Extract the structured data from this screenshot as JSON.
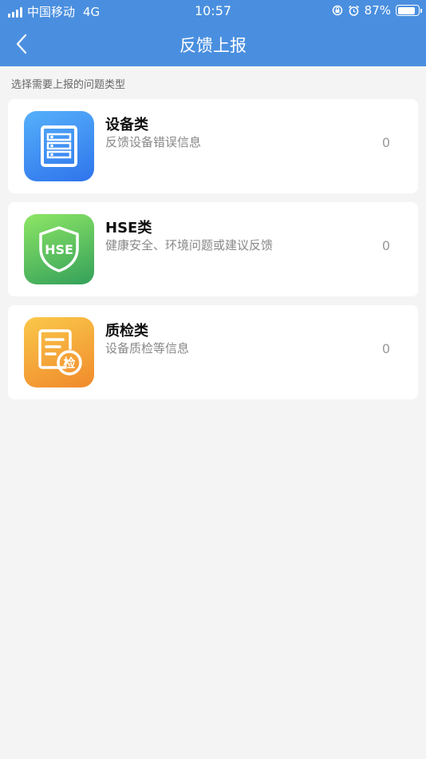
{
  "status_bar": {
    "carrier": "中国移动",
    "network": "4G",
    "time": "10:57",
    "battery": "87%",
    "battery_level": 0.87
  },
  "nav": {
    "title": "反馈上报"
  },
  "section_label": "选择需要上报的问题类型",
  "categories": [
    {
      "title": "设备类",
      "desc": "反馈设备错误信息",
      "count": "0",
      "icon": "server-icon",
      "color": "#3d8ff2"
    },
    {
      "title": "HSE类",
      "desc": "健康安全、环境问题或建议反馈",
      "count": "0",
      "icon": "shield-hse-icon",
      "icon_text": "HSE",
      "color": "#4fb05a"
    },
    {
      "title": "质检类",
      "desc": "设备质检等信息",
      "count": "0",
      "icon": "inspection-document-icon",
      "icon_text": "检",
      "color": "#f39b32"
    }
  ]
}
